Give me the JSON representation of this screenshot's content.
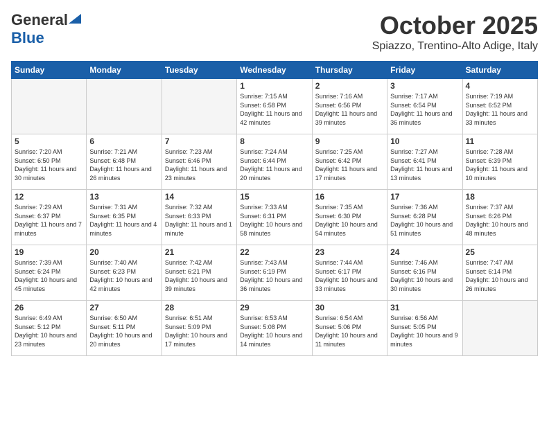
{
  "header": {
    "logo_general": "General",
    "logo_blue": "Blue",
    "month_title": "October 2025",
    "location": "Spiazzo, Trentino-Alto Adige, Italy"
  },
  "weekdays": [
    "Sunday",
    "Monday",
    "Tuesday",
    "Wednesday",
    "Thursday",
    "Friday",
    "Saturday"
  ],
  "weeks": [
    [
      {
        "day": "",
        "empty": true
      },
      {
        "day": "",
        "empty": true
      },
      {
        "day": "",
        "empty": true
      },
      {
        "day": "1",
        "sunrise": "7:15 AM",
        "sunset": "6:58 PM",
        "daylight": "11 hours and 42 minutes."
      },
      {
        "day": "2",
        "sunrise": "7:16 AM",
        "sunset": "6:56 PM",
        "daylight": "11 hours and 39 minutes."
      },
      {
        "day": "3",
        "sunrise": "7:17 AM",
        "sunset": "6:54 PM",
        "daylight": "11 hours and 36 minutes."
      },
      {
        "day": "4",
        "sunrise": "7:19 AM",
        "sunset": "6:52 PM",
        "daylight": "11 hours and 33 minutes."
      }
    ],
    [
      {
        "day": "5",
        "sunrise": "7:20 AM",
        "sunset": "6:50 PM",
        "daylight": "11 hours and 30 minutes."
      },
      {
        "day": "6",
        "sunrise": "7:21 AM",
        "sunset": "6:48 PM",
        "daylight": "11 hours and 26 minutes."
      },
      {
        "day": "7",
        "sunrise": "7:23 AM",
        "sunset": "6:46 PM",
        "daylight": "11 hours and 23 minutes."
      },
      {
        "day": "8",
        "sunrise": "7:24 AM",
        "sunset": "6:44 PM",
        "daylight": "11 hours and 20 minutes."
      },
      {
        "day": "9",
        "sunrise": "7:25 AM",
        "sunset": "6:42 PM",
        "daylight": "11 hours and 17 minutes."
      },
      {
        "day": "10",
        "sunrise": "7:27 AM",
        "sunset": "6:41 PM",
        "daylight": "11 hours and 13 minutes."
      },
      {
        "day": "11",
        "sunrise": "7:28 AM",
        "sunset": "6:39 PM",
        "daylight": "11 hours and 10 minutes."
      }
    ],
    [
      {
        "day": "12",
        "sunrise": "7:29 AM",
        "sunset": "6:37 PM",
        "daylight": "11 hours and 7 minutes."
      },
      {
        "day": "13",
        "sunrise": "7:31 AM",
        "sunset": "6:35 PM",
        "daylight": "11 hours and 4 minutes."
      },
      {
        "day": "14",
        "sunrise": "7:32 AM",
        "sunset": "6:33 PM",
        "daylight": "11 hours and 1 minute."
      },
      {
        "day": "15",
        "sunrise": "7:33 AM",
        "sunset": "6:31 PM",
        "daylight": "10 hours and 58 minutes."
      },
      {
        "day": "16",
        "sunrise": "7:35 AM",
        "sunset": "6:30 PM",
        "daylight": "10 hours and 54 minutes."
      },
      {
        "day": "17",
        "sunrise": "7:36 AM",
        "sunset": "6:28 PM",
        "daylight": "10 hours and 51 minutes."
      },
      {
        "day": "18",
        "sunrise": "7:37 AM",
        "sunset": "6:26 PM",
        "daylight": "10 hours and 48 minutes."
      }
    ],
    [
      {
        "day": "19",
        "sunrise": "7:39 AM",
        "sunset": "6:24 PM",
        "daylight": "10 hours and 45 minutes."
      },
      {
        "day": "20",
        "sunrise": "7:40 AM",
        "sunset": "6:23 PM",
        "daylight": "10 hours and 42 minutes."
      },
      {
        "day": "21",
        "sunrise": "7:42 AM",
        "sunset": "6:21 PM",
        "daylight": "10 hours and 39 minutes."
      },
      {
        "day": "22",
        "sunrise": "7:43 AM",
        "sunset": "6:19 PM",
        "daylight": "10 hours and 36 minutes."
      },
      {
        "day": "23",
        "sunrise": "7:44 AM",
        "sunset": "6:17 PM",
        "daylight": "10 hours and 33 minutes."
      },
      {
        "day": "24",
        "sunrise": "7:46 AM",
        "sunset": "6:16 PM",
        "daylight": "10 hours and 30 minutes."
      },
      {
        "day": "25",
        "sunrise": "7:47 AM",
        "sunset": "6:14 PM",
        "daylight": "10 hours and 26 minutes."
      }
    ],
    [
      {
        "day": "26",
        "sunrise": "6:49 AM",
        "sunset": "5:12 PM",
        "daylight": "10 hours and 23 minutes."
      },
      {
        "day": "27",
        "sunrise": "6:50 AM",
        "sunset": "5:11 PM",
        "daylight": "10 hours and 20 minutes."
      },
      {
        "day": "28",
        "sunrise": "6:51 AM",
        "sunset": "5:09 PM",
        "daylight": "10 hours and 17 minutes."
      },
      {
        "day": "29",
        "sunrise": "6:53 AM",
        "sunset": "5:08 PM",
        "daylight": "10 hours and 14 minutes."
      },
      {
        "day": "30",
        "sunrise": "6:54 AM",
        "sunset": "5:06 PM",
        "daylight": "10 hours and 11 minutes."
      },
      {
        "day": "31",
        "sunrise": "6:56 AM",
        "sunset": "5:05 PM",
        "daylight": "10 hours and 9 minutes."
      },
      {
        "day": "",
        "empty": true
      }
    ]
  ],
  "labels": {
    "sunrise": "Sunrise:",
    "sunset": "Sunset:",
    "daylight": "Daylight:"
  }
}
